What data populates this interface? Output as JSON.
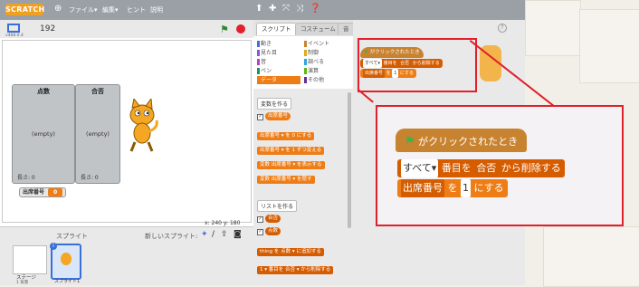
{
  "menubar": {
    "logo": "SCRATCH",
    "items": [
      "ファイル▾",
      "編集▾",
      "ヒント",
      "説明"
    ]
  },
  "stage": {
    "project_number": "192",
    "version": "v468.0.4",
    "lists": [
      {
        "title": "点数",
        "empty": "(empty)",
        "length": "長さ: 0"
      },
      {
        "title": "合否",
        "empty": "(empty)",
        "length": "長さ: 0"
      }
    ],
    "variable": {
      "name": "出席番号",
      "value": "0"
    },
    "coords": {
      "x_label": "x:",
      "x": "240",
      "y_label": "y:",
      "y": "180"
    }
  },
  "sprites": {
    "label": "スプライト",
    "new_sprite": "新しいスプライト:",
    "stage_label": "ステージ",
    "stage_sub": "1 背景",
    "sprite_name": "スプライト1"
  },
  "tabs": [
    "スクリプト",
    "コスチューム",
    "音"
  ],
  "categories": [
    {
      "label": "動き",
      "color": "#4a6cd4"
    },
    {
      "label": "イベント",
      "color": "#c88330"
    },
    {
      "label": "見た目",
      "color": "#8a55d7"
    },
    {
      "label": "制御",
      "color": "#e1a91a"
    },
    {
      "label": "音",
      "color": "#bb42c3"
    },
    {
      "label": "調べる",
      "color": "#2ca5e2"
    },
    {
      "label": "ペン",
      "color": "#0e9a6c"
    },
    {
      "label": "演算",
      "color": "#5cb712"
    },
    {
      "label": "データ",
      "color": "#ee7d16"
    },
    {
      "label": "その他",
      "color": "#632d99"
    }
  ],
  "palette": {
    "make_variable": "変数を作る",
    "var_reporter": "出席番号",
    "blocks": [
      "出席番号 ▾ を 0 にする",
      "出席番号 ▾ を 1 ずつ変える",
      "変数 出席番号 ▾ を表示する",
      "変数 出席番号 ▾ を隠す"
    ],
    "make_list": "リストを作る",
    "list_reporters": [
      "合否",
      "点数"
    ],
    "list_blocks": [
      "thing を 点数 ▾ に追加する",
      "1 ▾ 番目を 合否 ▾ から削除する"
    ]
  },
  "script": {
    "hat": "がクリックされたとき",
    "delete_prefix": "すべて▾",
    "delete_mid": "番目を",
    "delete_list": "合否",
    "delete_suffix": "から削除する",
    "set_var": "出席番号",
    "set_mid": "を",
    "set_val": "1",
    "set_suffix": "にする"
  },
  "colors": {
    "accent": "#ee7d16",
    "highlight": "#e0202a"
  }
}
